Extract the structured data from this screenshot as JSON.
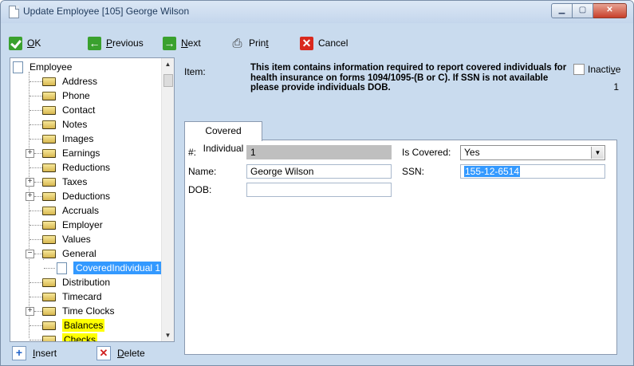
{
  "window": {
    "title": "Update Employee [105] George Wilson",
    "controls": {
      "minimize": "▁",
      "maximize": "▢",
      "close": "✕"
    }
  },
  "toolbar": {
    "ok": {
      "label_accel": "O",
      "label_rest": "K"
    },
    "previous": {
      "label_accel": "P",
      "label_rest": "revious"
    },
    "next": {
      "label_accel": "N",
      "label_rest": "ext"
    },
    "print": {
      "label_pre": "Prin",
      "label_accel": "t"
    },
    "cancel": {
      "label": "Cancel"
    }
  },
  "tree": {
    "root": "Employee",
    "items": [
      "Address",
      "Phone",
      "Contact",
      "Notes",
      "Images",
      "Earnings",
      "Reductions",
      "Taxes",
      "Deductions",
      "Accruals",
      "Employer",
      "Values",
      "General",
      "CoveredIndividual 1",
      "Distribution",
      "Timecard",
      "Time Clocks",
      "Balances",
      "Checks"
    ]
  },
  "bottom": {
    "insert": {
      "label_accel": "I",
      "label_rest": "nsert"
    },
    "delete": {
      "label_accel": "D",
      "label_rest": "elete"
    }
  },
  "item": {
    "label": "Item:",
    "description": "This item contains information required to report covered individuals for health insurance on forms 1094/1095-(B or C). If SSN is not available please provide individuals DOB.",
    "inactive_pre": "Inacti",
    "inactive_accel": "v",
    "inactive_post": "e",
    "count": "1"
  },
  "tab": {
    "label": "Covered Individual"
  },
  "form": {
    "number_label": "#:",
    "number_value": "1",
    "name_label": "Name:",
    "name_value": "George Wilson",
    "dob_label": "DOB:",
    "dob_value": "",
    "is_covered_label": "Is Covered:",
    "is_covered_value": "Yes",
    "ssn_label": "SSN:",
    "ssn_value": "155-12-6514"
  },
  "colors": {
    "accent_green": "#3aa12e",
    "cancel_red": "#d9281d",
    "selection_blue": "#3399ff",
    "highlight_yellow": "#ffff00",
    "window_bg": "#c9dbee"
  }
}
